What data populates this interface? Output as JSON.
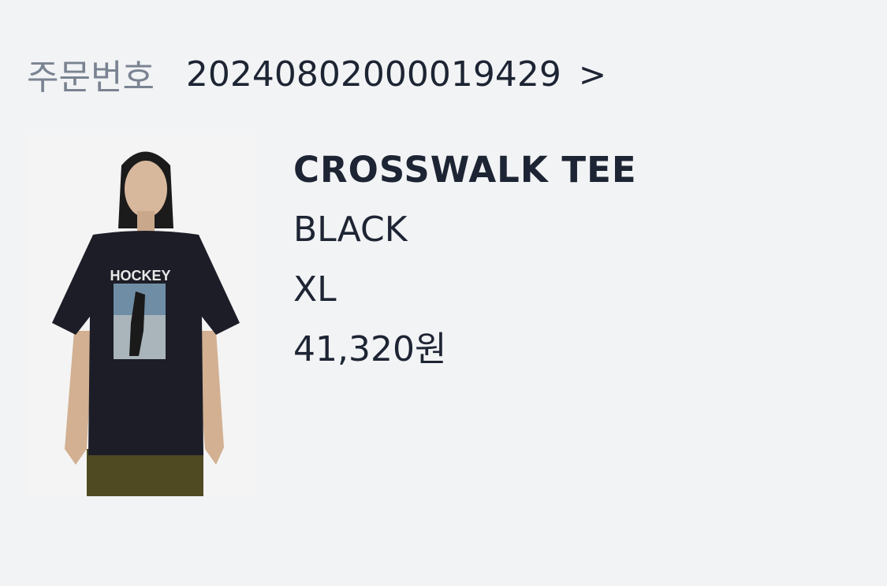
{
  "order": {
    "label": "주문번호",
    "number": "20240802000019429",
    "chevron": ">"
  },
  "product": {
    "image_icon": "product-photo",
    "print_text": "HOCKEY",
    "name": "CROSSWALK TEE",
    "color": "BLACK",
    "size": "XL",
    "price": "41,320원"
  },
  "colors": {
    "background": "#f2f3f5",
    "label": "#7a8391",
    "text": "#1d2433"
  }
}
